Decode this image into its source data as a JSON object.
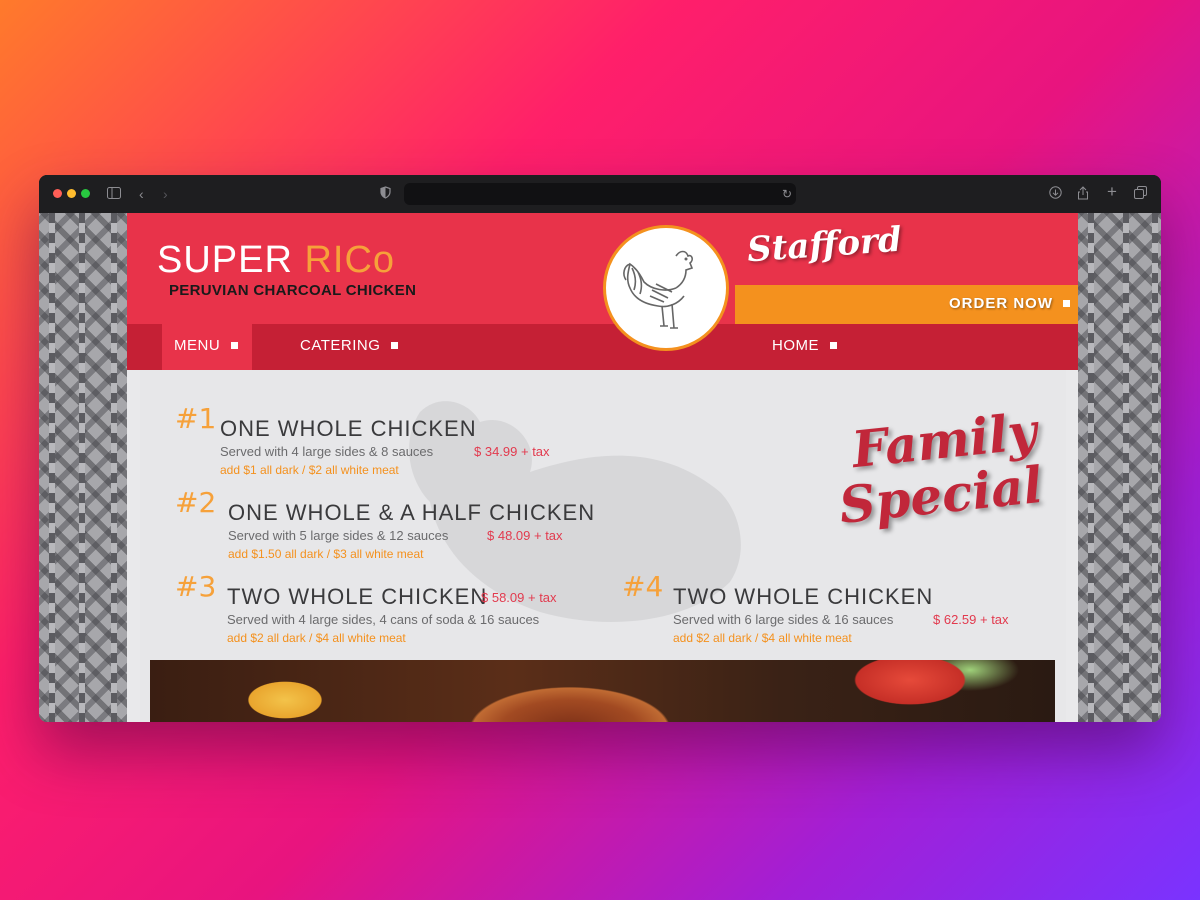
{
  "browser": {
    "url": "",
    "controls": [
      "close-dot",
      "minimize-dot",
      "zoom-dot",
      "sidebar-icon",
      "back-icon",
      "forward-icon",
      "shield-icon",
      "reload-icon",
      "download-icon",
      "share-icon",
      "new-tab-icon",
      "tabs-icon"
    ]
  },
  "header": {
    "brand_super": "SUPER",
    "brand_rico": "RICo",
    "tagline": "PERUVIAN CHARCOAL CHICKEN",
    "location": "Stafford",
    "order_now": "ORDER NOW"
  },
  "nav": {
    "menu": "MENU",
    "catering": "CATERING",
    "home": "HOME"
  },
  "specials": {
    "heading_line1": "Family",
    "heading_line2": "Special",
    "items": [
      {
        "num": "#1",
        "title": "ONE WHOLE CHICKEN",
        "desc": "Served with 4 large sides & 8 sauces",
        "price": "$ 34.99 + tax",
        "note": "add $1 all dark / $2 all white meat"
      },
      {
        "num": "#2",
        "title": "ONE WHOLE & A HALF CHICKEN",
        "desc": "Served with 5 large sides & 12 sauces",
        "price": "$ 48.09 + tax",
        "note": "add $1.50 all dark / $3 all white meat"
      },
      {
        "num": "#3",
        "title": "TWO WHOLE CHICKEN",
        "desc": "Served with 4 large sides, 4 cans of soda & 16 sauces",
        "price": "$ 58.09 + tax",
        "note": "add $2 all dark / $4 all white meat"
      },
      {
        "num": "#4",
        "title": "TWO WHOLE CHICKEN",
        "desc": "Served with 6 large sides & 16 sauces",
        "price": "$ 62.59 + tax",
        "note": "add $2 all dark / $4 all white meat"
      }
    ]
  },
  "colors": {
    "brand_red": "#e8334a",
    "nav_red": "#c52035",
    "accent_orange": "#f4911e",
    "gold": "#f6a13a"
  }
}
